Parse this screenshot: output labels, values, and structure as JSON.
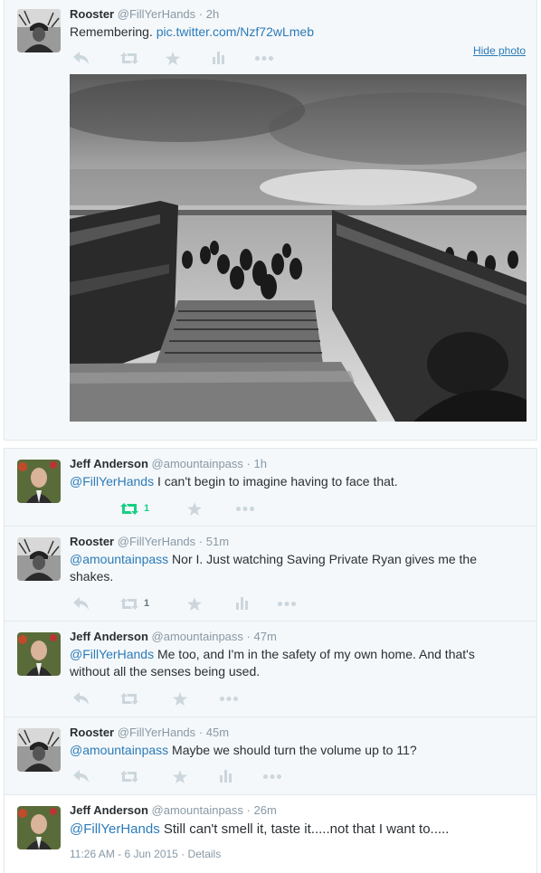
{
  "main_tweet": {
    "name": "Rooster",
    "handle": "@FillYerHands",
    "time": "2h",
    "text": "Remembering.",
    "link": "pic.twitter.com/Nzf72wLmeb",
    "hide_photo": "Hide photo",
    "photo_description": "Black and white photograph of soldiers wading ashore from a landing craft onto a beach"
  },
  "replies": [
    {
      "name": "Jeff Anderson",
      "handle": "@amountainpass",
      "time": "1h",
      "mention": "@FillYerHands",
      "text": " I can't begin to imagine having to face that.",
      "retweet_count": "1",
      "retweeted": true,
      "avatar": "jeff"
    },
    {
      "name": "Rooster",
      "handle": "@FillYerHands",
      "time": "51m",
      "mention": "@amountainpass",
      "text": " Nor I. Just watching Saving Private Ryan gives me the shakes.",
      "retweet_count": "1",
      "retweeted": false,
      "avatar": "rooster"
    },
    {
      "name": "Jeff Anderson",
      "handle": "@amountainpass",
      "time": "47m",
      "mention": "@FillYerHands",
      "text": " Me too, and I'm in the safety of my own home. And that's without all the senses being used.",
      "retweet_count": "",
      "retweeted": false,
      "avatar": "jeff"
    },
    {
      "name": "Rooster",
      "handle": "@FillYerHands",
      "time": "45m",
      "mention": "@amountainpass",
      "text": " Maybe we should turn the volume up to 11?",
      "retweet_count": "",
      "retweeted": false,
      "avatar": "rooster"
    }
  ],
  "final_tweet": {
    "name": "Jeff Anderson",
    "handle": "@amountainpass",
    "time": "26m",
    "mention": "@FillYerHands",
    "text": " Still can't smell it, taste it.....not that I want to.....",
    "timestamp": "11:26 AM - 6 Jun 2015",
    "separator": "·",
    "details": "Details"
  },
  "icons": {
    "reply": "reply-icon",
    "retweet": "retweet-icon",
    "favorite": "star-icon",
    "analytics": "analytics-icon",
    "more": "more-icon"
  },
  "colors": {
    "link": "#2b7bb9",
    "retweet_active": "#19cf86",
    "action_icon": "#ccd6dd",
    "background": "#f5f8fa"
  },
  "dot": "·"
}
